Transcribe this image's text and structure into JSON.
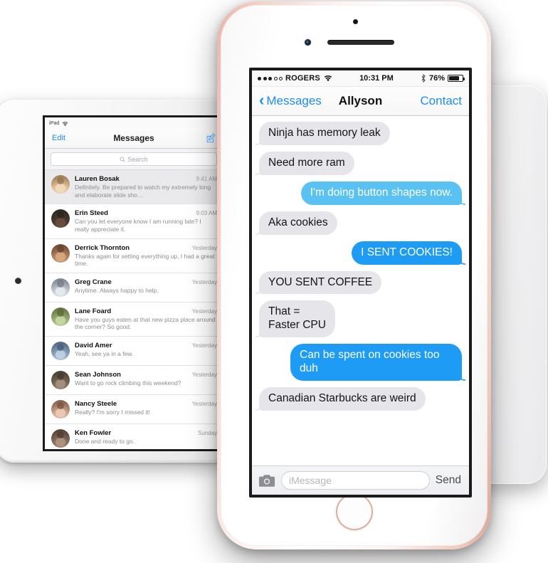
{
  "theme": {
    "accent_blue": "#1f8cf6",
    "bubble_gray": "#e6e5ea",
    "bubble_blue_light": "#5ac2f2",
    "bubble_blue": "#1e9cf5",
    "rose_gold": "#e8b4a8"
  },
  "ipad": {
    "status": {
      "device_label": "iPad",
      "wifi_icon": "wifi-icon"
    },
    "navbar": {
      "edit_label": "Edit",
      "title": "Messages",
      "compose_icon": "compose-icon"
    },
    "search": {
      "placeholder": "Search",
      "icon": "search-icon"
    },
    "threads": [
      {
        "name": "Lauren Bosak",
        "time": "9:41 AM",
        "preview": "Definitely. Be prepared to watch my extremely long and elaborate slide sho…",
        "selected": true,
        "avatar": "avatar-lauren"
      },
      {
        "name": "Erin Steed",
        "time": "9:03 AM",
        "preview": "Can you let everyone know I am running late? I really appreciate it.",
        "selected": false,
        "avatar": "avatar-erin"
      },
      {
        "name": "Derrick Thornton",
        "time": "Yesterday",
        "preview": "Thanks again for setting everything up, I had a great time.",
        "selected": false,
        "avatar": "avatar-derrick"
      },
      {
        "name": "Greg Crane",
        "time": "Yesterday",
        "preview": "Anytime. Always happy to help.",
        "selected": false,
        "avatar": "avatar-greg"
      },
      {
        "name": "Lane Foard",
        "time": "Yesterday",
        "preview": "Have you guys eaten at that new pizza place around the corner? So good.",
        "selected": false,
        "avatar": "avatar-lane"
      },
      {
        "name": "David Amer",
        "time": "Yesterday",
        "preview": "Yeah, see ya in a few.",
        "selected": false,
        "avatar": "avatar-david"
      },
      {
        "name": "Sean Johnson",
        "time": "Yesterday",
        "preview": "Want to go rock climbing this weekend?",
        "selected": false,
        "avatar": "avatar-sean"
      },
      {
        "name": "Nancy Steele",
        "time": "Yesterday",
        "preview": "Really? I'm sorry I missed it!",
        "selected": false,
        "avatar": "avatar-nancy"
      },
      {
        "name": "Ken Fowler",
        "time": "Sunday",
        "preview": "Done and ready to go.",
        "selected": false,
        "avatar": "avatar-ken"
      }
    ]
  },
  "iphone": {
    "status": {
      "signal_dots_filled": 3,
      "signal_dots_total": 5,
      "carrier": "ROGERS",
      "wifi_icon": "wifi-icon",
      "time": "10:31 PM",
      "bluetooth_icon": "bluetooth-icon",
      "battery_percent": "76%",
      "battery_level": 76
    },
    "navbar": {
      "back_label": "Messages",
      "back_icon": "chevron-left-icon",
      "title": "Allyson",
      "contact_label": "Contact"
    },
    "messages": [
      {
        "text": "Ninja has memory leak",
        "from": "them",
        "style": "gray"
      },
      {
        "text": "Need more ram",
        "from": "them",
        "style": "gray"
      },
      {
        "text": "I'm doing button shapes now.",
        "from": "me",
        "style": "blue-light"
      },
      {
        "text": "Aka cookies",
        "from": "them",
        "style": "gray"
      },
      {
        "text": "I SENT COOKIES!",
        "from": "me",
        "style": "blue"
      },
      {
        "text": "YOU SENT COFFEE",
        "from": "them",
        "style": "gray"
      },
      {
        "text": "That =\nFaster CPU",
        "from": "them",
        "style": "gray"
      },
      {
        "text": "Can be spent on cookies too duh",
        "from": "me",
        "style": "blue"
      },
      {
        "text": "Canadian Starbucks are weird",
        "from": "them",
        "style": "gray"
      }
    ],
    "input_bar": {
      "camera_icon": "camera-icon",
      "placeholder": "iMessage",
      "value": "",
      "send_label": "Send"
    }
  }
}
